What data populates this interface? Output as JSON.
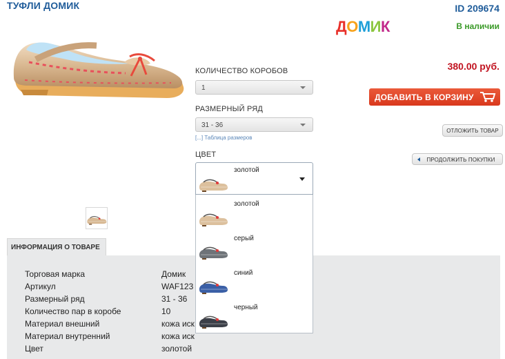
{
  "product": {
    "title": "ТУФЛИ ДОМИК",
    "id": "ID 209674",
    "brand_letters": [
      "Д",
      "О",
      "М",
      "И",
      "К"
    ],
    "brand_colors": [
      "#e8312b",
      "#f7a21b",
      "#1e9fd8",
      "#8cc63f",
      "#c2298a"
    ],
    "availability": "В наличии",
    "price": "380.00 руб."
  },
  "form": {
    "boxes_label": "КОЛИЧЕСТВО КОРОБОВ",
    "boxes_value": "1",
    "sizes_label": "РАЗМЕРНЫЙ РЯД",
    "sizes_value": "31 - 36",
    "size_table_link": "[...] Таблица размеров",
    "color_label": "ЦВЕТ",
    "color_value": "золотой",
    "color_options": [
      {
        "label": "золотой",
        "icon": "gold-shoe-icon"
      },
      {
        "label": "серый",
        "icon": "gray-shoe-icon"
      },
      {
        "label": "синий",
        "icon": "blue-shoe-icon"
      },
      {
        "label": "черный",
        "icon": "black-shoe-icon"
      }
    ]
  },
  "actions": {
    "add_to_cart": "ДОБАВИТЬ В КОРЗИНУ",
    "postpone": "ОТЛОЖИТЬ ТОВАР",
    "continue": "ПРОДОЛЖИТЬ ПОКУПКИ"
  },
  "info": {
    "tab_label": "ИНФОРМАЦИЯ О ТОВАРЕ",
    "rows": [
      {
        "label": "Торговая марка",
        "value": "Домик"
      },
      {
        "label": "Артикул",
        "value": "WAF123"
      },
      {
        "label": "Размерный ряд",
        "value": "31 - 36"
      },
      {
        "label": "Количество пар в коробе",
        "value": "10"
      },
      {
        "label": "Материал внешний",
        "value": "кожа иск"
      },
      {
        "label": "Материал внутренний",
        "value": "кожа иск"
      },
      {
        "label": "Цвет",
        "value": "золотой"
      }
    ]
  },
  "colors": {
    "accent_blue": "#1f5c9a",
    "in_stock_green": "#3a9a28",
    "price_red": "#c1121f",
    "cart_button": "#d9381c"
  }
}
